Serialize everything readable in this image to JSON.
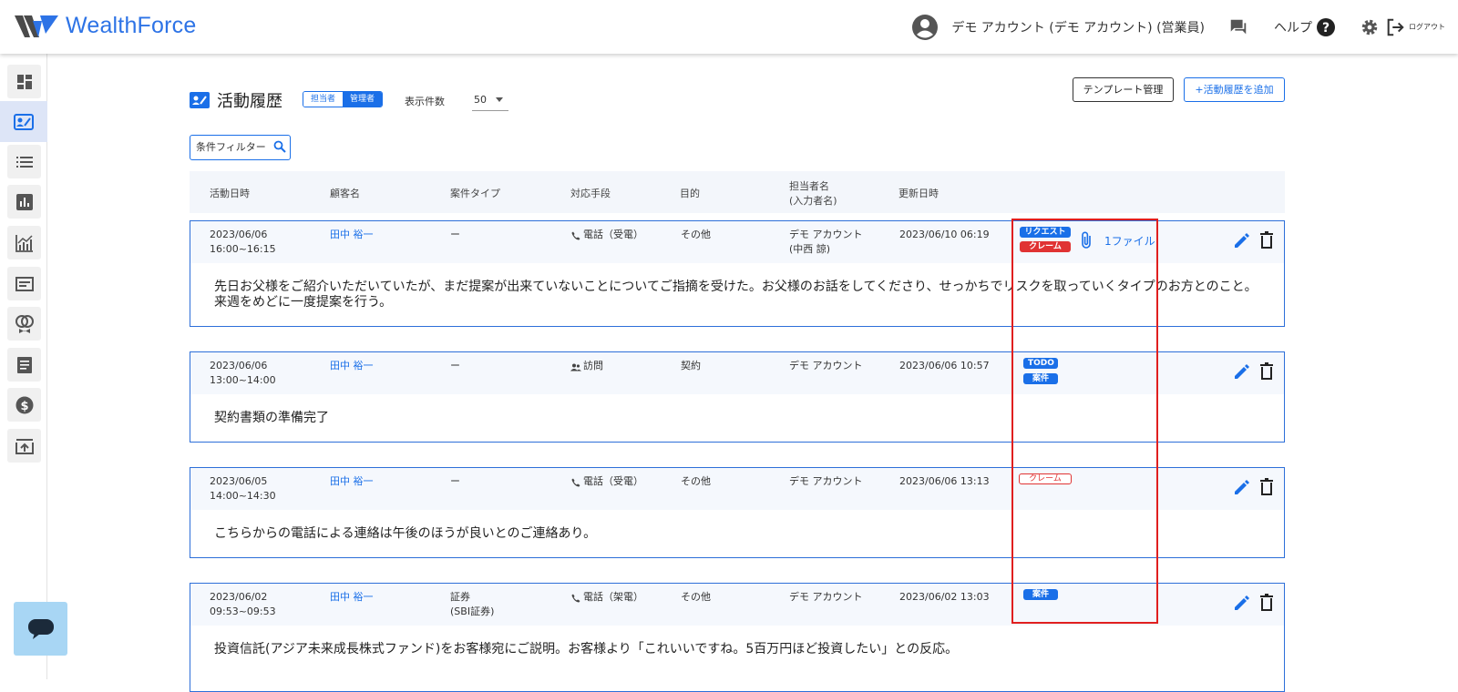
{
  "app": {
    "brand": "WealthForce"
  },
  "header": {
    "account_label": "デモ アカウント (デモ アカウント) (営業員)",
    "help_label": "ヘルプ",
    "logout_label": "ログアウト"
  },
  "sidebar": {
    "items": [
      {
        "icon": "dashboard-icon"
      },
      {
        "icon": "activity-history-icon",
        "active": true
      },
      {
        "icon": "list-icon"
      },
      {
        "icon": "bar-chart-icon"
      },
      {
        "icon": "trend-chart-icon"
      },
      {
        "icon": "card-icon"
      },
      {
        "icon": "ring-icon"
      },
      {
        "icon": "document-icon"
      },
      {
        "icon": "dollar-icon"
      },
      {
        "icon": "export-icon"
      }
    ]
  },
  "page": {
    "title": "活動履歴",
    "role_tabs": [
      "担当者",
      "管理者"
    ],
    "count_label": "表示件数",
    "count_value": "50",
    "template_button": "テンプレート管理",
    "add_button": "+活動履歴を追加",
    "filter_label": "条件フィルター"
  },
  "table": {
    "columns": [
      "活動日時",
      "顧客名",
      "案件タイプ",
      "対応手段",
      "目的",
      "担当者名",
      "(入力者名)",
      "更新日時"
    ],
    "rows": [
      {
        "date": "2023/06/06",
        "time": "16:00~16:15",
        "customer": "田中 裕一",
        "case_type": "ー",
        "case_type_sub": "",
        "method": "電話（受電）",
        "method_icon": "phone-icon",
        "purpose": "その他",
        "staff": "デモ アカウント",
        "staff_sub": "(中西 諒)",
        "updated": "2023/06/10 06:19",
        "tags": [
          {
            "label": "リクエスト",
            "style": "blue"
          },
          {
            "label": "クレーム",
            "style": "red"
          }
        ],
        "file": "1ファイル",
        "body": "先日お父様をご紹介いただいていたが、まだ提案が出来ていないことについてご指摘を受けた。お父様のお話をしてくださり、せっかちでリスクを取っていくタイプのお方とのこと。来週をめどに一度提案を行う。"
      },
      {
        "date": "2023/06/06",
        "time": "13:00~14:00",
        "customer": "田中 裕一",
        "case_type": "ー",
        "case_type_sub": "",
        "method": "訪問",
        "method_icon": "people-icon",
        "purpose": "契約",
        "staff": "デモ アカウント",
        "staff_sub": "",
        "updated": "2023/06/06 10:57",
        "tags": [
          {
            "label": "TODO",
            "style": "blue"
          },
          {
            "label": "案件",
            "style": "blue"
          }
        ],
        "file": "",
        "body": "契約書類の準備完了"
      },
      {
        "date": "2023/06/05",
        "time": "14:00~14:30",
        "customer": "田中 裕一",
        "case_type": "ー",
        "case_type_sub": "",
        "method": "電話（受電）",
        "method_icon": "phone-icon",
        "purpose": "その他",
        "staff": "デモ アカウント",
        "staff_sub": "",
        "updated": "2023/06/06 13:13",
        "tags": [
          {
            "label": "クレーム",
            "style": "red-outline"
          }
        ],
        "file": "",
        "body": "こちらからの電話による連絡は午後のほうが良いとのご連絡あり。"
      },
      {
        "date": "2023/06/02",
        "time": "09:53~09:53",
        "customer": "田中 裕一",
        "case_type": "証券",
        "case_type_sub": "(SBI証券)",
        "method": "電話（架電）",
        "method_icon": "phone-icon",
        "purpose": "その他",
        "staff": "デモ アカウント",
        "staff_sub": "",
        "updated": "2023/06/02 13:03",
        "tags": [
          {
            "label": "案件",
            "style": "blue"
          }
        ],
        "file": "",
        "body": "投資信託(アジア未来成長株式ファンド)をお客様宛にご説明。お客様より「これいいですね。5百万円ほど投資したい」との反応。"
      }
    ]
  },
  "colors": {
    "brand": "#2d73e6",
    "accent": "#1a6fe8",
    "danger": "#e03333",
    "highlight": "#e01f1f"
  }
}
